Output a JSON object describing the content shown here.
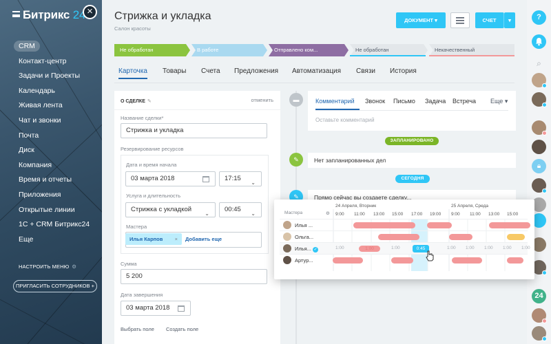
{
  "app": {
    "logo": "Битрикс",
    "logo_num": "24"
  },
  "sidebar": {
    "items": [
      {
        "label": "CRM",
        "active": true
      },
      {
        "label": "Контакт-центр"
      },
      {
        "label": "Задачи и Проекты"
      },
      {
        "label": "Календарь"
      },
      {
        "label": "Живая лента"
      },
      {
        "label": "Чат и звонки"
      },
      {
        "label": "Почта"
      },
      {
        "label": "Диск"
      },
      {
        "label": "Компания"
      },
      {
        "label": "Время и отчеты"
      },
      {
        "label": "Приложения"
      },
      {
        "label": "Открытые линии"
      },
      {
        "label": "1С + CRM Битрикс24"
      },
      {
        "label": "Еще"
      }
    ],
    "config_label": "НАСТРОИТЬ МЕНЮ",
    "invite_label": "ПРИГЛАСИТЬ СОТРУДНИКОВ +"
  },
  "header": {
    "title": "Стрижка и укладка",
    "subtitle": "Салон красоты",
    "document_button": "ДОКУМЕНТ",
    "invoice_button": "СЧЕТ"
  },
  "stages": [
    {
      "label": "Не обработан",
      "color": "#8bc43f",
      "text": "#ffffff"
    },
    {
      "label": "В работе",
      "color": "#a9d9f0",
      "text": "#ffffff"
    },
    {
      "label": "Отправлено ком...",
      "color": "#8e6ea3",
      "text": "#ffffff"
    },
    {
      "label": "Не обработан",
      "color": "#e3e7ea",
      "text": "#535c69"
    },
    {
      "label": "Некачественный",
      "color": "#e3e7ea",
      "text": "#535c69"
    }
  ],
  "tabs": [
    "Карточка",
    "Товары",
    "Счета",
    "Предложения",
    "Автоматизация",
    "Связи",
    "История"
  ],
  "card": {
    "header": "О СДЕЛКЕ",
    "cancel": "отменить",
    "deal_name_label": "Название сделки*",
    "deal_name_value": "Стрижка и укладка",
    "resources_label": "Резервирование ресурсов",
    "datetime_label": "Дата и время начала",
    "date_value": "03 марта 2018",
    "time_value": "17:15",
    "service_label": "Услуга и длительность",
    "service_value": "Стрижка с укладкой",
    "duration_value": "00:45",
    "masters_label": "Мастера",
    "master_tag": "Илья Карпов",
    "add_more": "Добавить еще",
    "sum_label": "Сумма",
    "sum_value": "5 200",
    "end_date_label": "Дата завершения",
    "end_date_value": "03 марта 2018",
    "choose_field": "Выбрать поле",
    "create_field": "Создать поле"
  },
  "timeline": {
    "comment_tabs": [
      "Комментарий",
      "Звонок",
      "Письмо",
      "Задача",
      "Встреча",
      "Еще"
    ],
    "comment_placeholder": "Оставьте комментарий",
    "planned_badge": "ЗАПЛАНИРОВАНО",
    "no_planned": "Нет запланированных дел",
    "today_badge": "СЕГОДНЯ",
    "creating_deal": "Прямо сейчас вы создаете сделку..."
  },
  "scheduler": {
    "masters_header": "Мастера",
    "day1": "24 Апреля, Вторник",
    "day2": "25 Апреля, Среда",
    "hours": [
      "9:00",
      "11:00",
      "13:00",
      "15:00",
      "17:00",
      "19:00",
      "9:00",
      "11:00",
      "13:00",
      "15:00"
    ],
    "rows": [
      {
        "name": "Илья ..."
      },
      {
        "name": "Ольга..."
      },
      {
        "name": "Илья..."
      },
      {
        "name": "Артур..."
      }
    ],
    "slot_label": "1:00",
    "selected_label": "0:45"
  },
  "colors": {
    "accent": "#2fc6f6",
    "link": "#2067b0",
    "busy": "#f39899",
    "warning": "#f7c966",
    "green": "#8bc43f",
    "planned_badge": "#7bb527",
    "today_badge": "#2fc6f6"
  }
}
